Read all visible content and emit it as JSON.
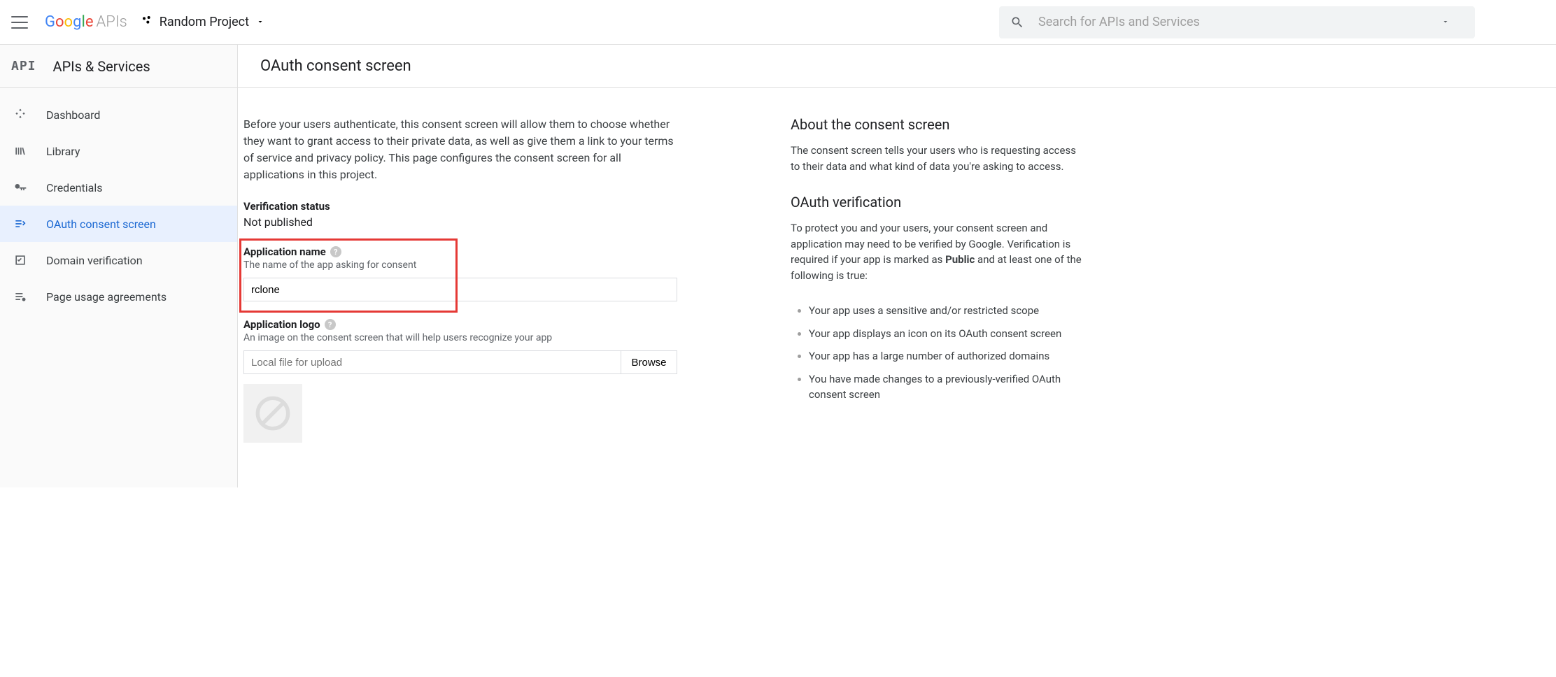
{
  "header": {
    "logo_text": "APIs",
    "project_name": "Random Project",
    "search_placeholder": "Search for APIs and Services"
  },
  "section": {
    "title": "APIs & Services",
    "page_title": "OAuth consent screen"
  },
  "sidebar": {
    "items": [
      {
        "label": "Dashboard"
      },
      {
        "label": "Library"
      },
      {
        "label": "Credentials"
      },
      {
        "label": "OAuth consent screen"
      },
      {
        "label": "Domain verification"
      },
      {
        "label": "Page usage agreements"
      }
    ]
  },
  "main": {
    "intro": "Before your users authenticate, this consent screen will allow them to choose whether they want to grant access to their private data, as well as give them a link to your terms of service and privacy policy. This page configures the consent screen for all applications in this project.",
    "verification_status_label": "Verification status",
    "verification_status_value": "Not published",
    "app_name_label": "Application name",
    "app_name_help": "The name of the app asking for consent",
    "app_name_value": "rclone",
    "app_logo_label": "Application logo",
    "app_logo_help": "An image on the consent screen that will help users recognize your app",
    "app_logo_placeholder": "Local file for upload",
    "browse_label": "Browse"
  },
  "right": {
    "about_title": "About the consent screen",
    "about_body": "The consent screen tells your users who is requesting access to their data and what kind of data you're asking to access.",
    "oauth_title": "OAuth verification",
    "oauth_body_pre": "To protect you and your users, your consent screen and application may need to be verified by Google. Verification is required if your app is marked as ",
    "oauth_body_strong": "Public",
    "oauth_body_post": " and at least one of the following is true:",
    "bullets": [
      "Your app uses a sensitive and/or restricted scope",
      "Your app displays an icon on its OAuth consent screen",
      "Your app has a large number of authorized domains",
      "You have made changes to a previously-verified OAuth consent screen"
    ]
  }
}
